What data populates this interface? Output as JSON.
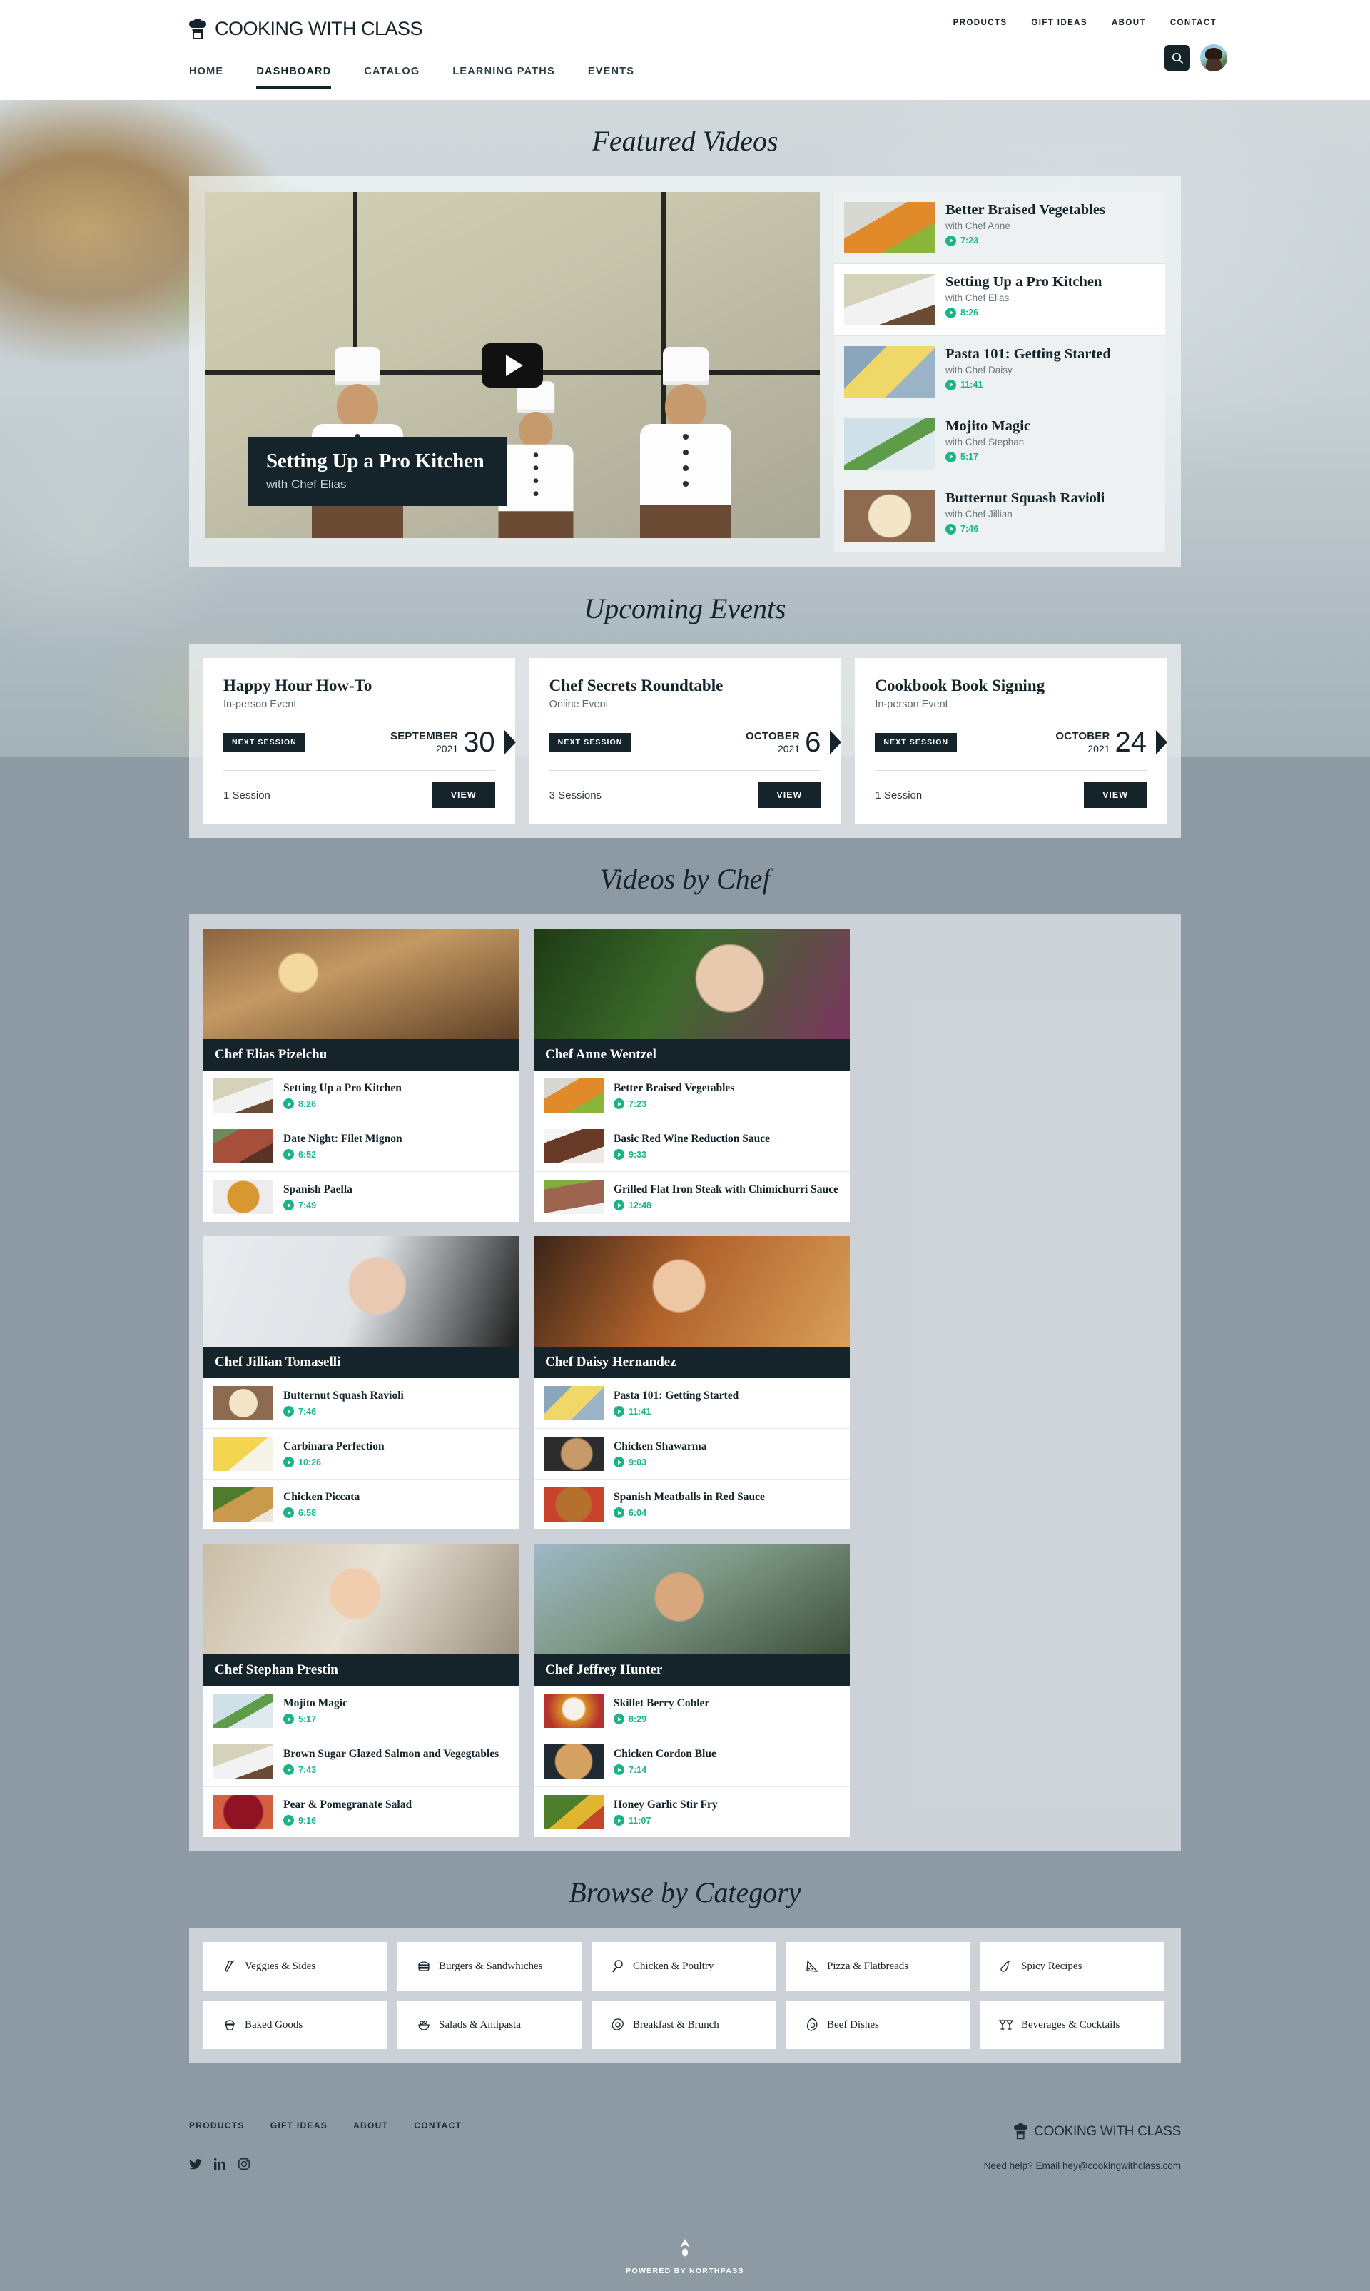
{
  "header": {
    "brand": "COOKING WITH CLASS",
    "brand_icon": "chef-hat-icon",
    "top_nav": [
      "PRODUCTS",
      "GIFT IDEAS",
      "ABOUT",
      "CONTACT"
    ],
    "main_nav": [
      {
        "label": "HOME",
        "active": false
      },
      {
        "label": "DASHBOARD",
        "active": true
      },
      {
        "label": "CATALOG",
        "active": false
      },
      {
        "label": "LEARNING PATHS",
        "active": false
      },
      {
        "label": "EVENTS",
        "active": false
      }
    ],
    "search_icon": "search-icon",
    "avatar_alt": "user-avatar"
  },
  "featured": {
    "title": "Featured Videos",
    "player": {
      "title": "Setting Up a Pro Kitchen",
      "subtitle": "with Chef Elias",
      "play_icon": "play-icon"
    },
    "playlist": [
      {
        "title": "Better Braised Vegetables",
        "subtitle": "with Chef Anne",
        "duration": "7:23",
        "active": false
      },
      {
        "title": "Setting Up a Pro Kitchen",
        "subtitle": "with Chef Elias",
        "duration": "8:26",
        "active": true
      },
      {
        "title": "Pasta 101: Getting Started",
        "subtitle": "with Chef Daisy",
        "duration": "11:41",
        "active": false
      },
      {
        "title": "Mojito Magic",
        "subtitle": "with Chef Stephan",
        "duration": "5:17",
        "active": false
      },
      {
        "title": "Butternut Squash Ravioli",
        "subtitle": "with Chef Jillian",
        "duration": "7:46",
        "active": false
      }
    ]
  },
  "events": {
    "title": "Upcoming Events",
    "badge_label": "NEXT SESSION",
    "view_label": "VIEW",
    "items": [
      {
        "title": "Happy Hour How-To",
        "type": "In-person Event",
        "month": "SEPTEMBER",
        "year": "2021",
        "day": "30",
        "sessions": "1 Session"
      },
      {
        "title": "Chef Secrets Roundtable",
        "type": "Online Event",
        "month": "OCTOBER",
        "year": "2021",
        "day": "6",
        "sessions": "3 Sessions"
      },
      {
        "title": "Cookbook Book Signing",
        "type": "In-person Event",
        "month": "OCTOBER",
        "year": "2021",
        "day": "24",
        "sessions": "1 Session"
      }
    ]
  },
  "chefs": {
    "title": "Videos by Chef",
    "cards": [
      {
        "name": "Chef Elias Pizelchu",
        "videos": [
          {
            "title": "Setting Up a Pro Kitchen",
            "duration": "8:26"
          },
          {
            "title": "Date Night: Filet Mignon",
            "duration": "6:52"
          },
          {
            "title": "Spanish Paella",
            "duration": "7:49"
          }
        ]
      },
      {
        "name": "Chef Anne Wentzel",
        "videos": [
          {
            "title": "Better Braised Vegetables",
            "duration": "7:23"
          },
          {
            "title": "Basic Red Wine Reduction Sauce",
            "duration": "9:33"
          },
          {
            "title": "Grilled Flat Iron Steak with Chimichurri Sauce",
            "duration": "12:48"
          }
        ]
      },
      {
        "name": "Chef Jillian Tomaselli",
        "videos": [
          {
            "title": "Butternut Squash Ravioli",
            "duration": "7:46"
          },
          {
            "title": "Carbinara Perfection",
            "duration": "10:26"
          },
          {
            "title": "Chicken Piccata",
            "duration": "6:58"
          }
        ]
      },
      {
        "name": "Chef Daisy Hernandez",
        "videos": [
          {
            "title": "Pasta 101: Getting Started",
            "duration": "11:41"
          },
          {
            "title": "Chicken Shawarma",
            "duration": "9:03"
          },
          {
            "title": "Spanish Meatballs in Red Sauce",
            "duration": "6:04"
          }
        ]
      },
      {
        "name": "Chef Stephan Prestin",
        "videos": [
          {
            "title": "Mojito Magic",
            "duration": "5:17"
          },
          {
            "title": "Brown Sugar Glazed Salmon and Vegegtables",
            "duration": "7:43"
          },
          {
            "title": "Pear & Pomegranate Salad",
            "duration": "9:16"
          }
        ]
      },
      {
        "name": "Chef Jeffrey Hunter",
        "videos": [
          {
            "title": "Skillet Berry Cobler",
            "duration": "8:29"
          },
          {
            "title": "Chicken Cordon Blue",
            "duration": "7:14"
          },
          {
            "title": "Honey Garlic Stir Fry",
            "duration": "11:07"
          }
        ]
      }
    ]
  },
  "categories": {
    "title": "Browse by Category",
    "items": [
      {
        "label": "Veggies & Sides",
        "icon": "asparagus-icon"
      },
      {
        "label": "Burgers & Sandwhiches",
        "icon": "burger-icon"
      },
      {
        "label": "Chicken & Poultry",
        "icon": "drumstick-icon"
      },
      {
        "label": "Pizza & Flatbreads",
        "icon": "pizza-slice-icon"
      },
      {
        "label": "Spicy Recipes",
        "icon": "chili-pepper-icon"
      },
      {
        "label": "Baked Goods",
        "icon": "cupcake-icon"
      },
      {
        "label": "Salads & Antipasta",
        "icon": "salad-bowl-icon"
      },
      {
        "label": "Breakfast & Brunch",
        "icon": "fried-egg-icon"
      },
      {
        "label": "Beef Dishes",
        "icon": "steak-icon"
      },
      {
        "label": "Beverages & Cocktails",
        "icon": "cocktail-glasses-icon"
      }
    ]
  },
  "footer": {
    "nav": [
      "PRODUCTS",
      "GIFT IDEAS",
      "ABOUT",
      "CONTACT"
    ],
    "social": [
      "twitter-icon",
      "linkedin-icon",
      "instagram-icon"
    ],
    "brand": "COOKING WITH CLASS",
    "help_prefix": "Need help? Email ",
    "help_email": "hey@cookingwithclass.com",
    "powered": "POWERED BY NORTHPASS"
  },
  "colors": {
    "dark": "#15232b",
    "accent_green": "#19b589",
    "page_bg": "#8d9aa4",
    "panel_bg": "#f4f6f7"
  }
}
